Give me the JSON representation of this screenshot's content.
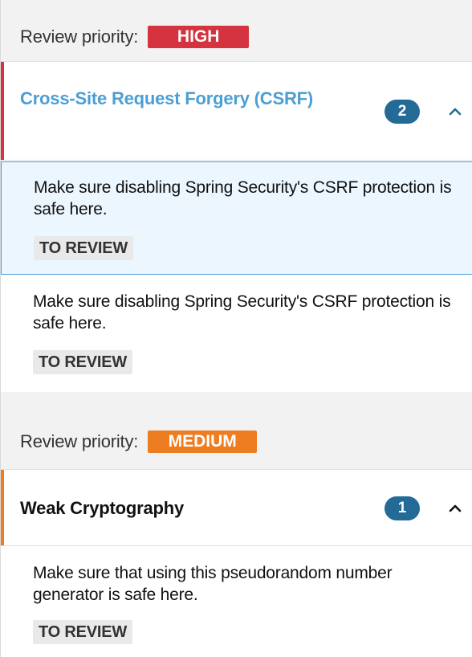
{
  "groups": [
    {
      "priority_label": "Review priority:",
      "priority_value": "HIGH",
      "priority_color": "#d4333f",
      "category": {
        "title": "Cross-Site Request Forgery (CSRF)",
        "count": "2",
        "title_color": "#4b9fd5",
        "expanded_icon": "chevron-up-icon"
      },
      "hotspots": [
        {
          "message": "Make sure disabling Spring Security's CSRF protection is safe here.",
          "status": "TO REVIEW",
          "selected": true
        },
        {
          "message": "Make sure disabling Spring Security's CSRF protection is safe here.",
          "status": "TO REVIEW",
          "selected": false
        }
      ]
    },
    {
      "priority_label": "Review priority:",
      "priority_value": "MEDIUM",
      "priority_color": "#ed7d20",
      "category": {
        "title": "Weak Cryptography",
        "count": "1",
        "title_color": "#111111",
        "expanded_icon": "chevron-up-icon"
      },
      "hotspots": [
        {
          "message": "Make sure that using this pseudorandom number generator is safe here.",
          "status": "TO REVIEW",
          "selected": false
        }
      ]
    }
  ],
  "colors": {
    "count_pill": "#236a97",
    "selection_border": "#4b9fd5",
    "selection_background": "#ecf6fe"
  }
}
